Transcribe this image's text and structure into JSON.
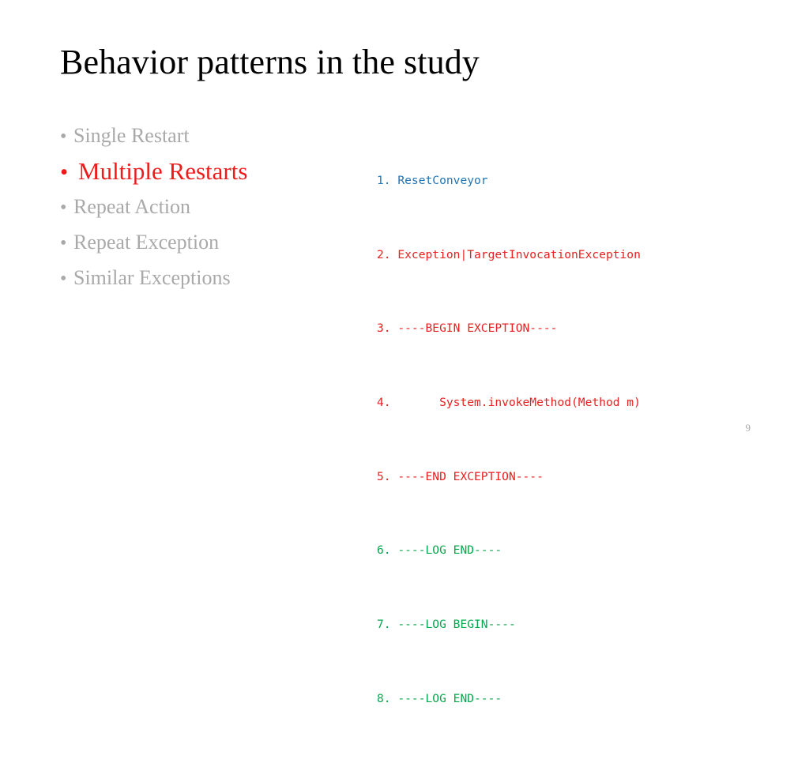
{
  "slide": {
    "title": "Behavior patterns in the study",
    "page_number": "9",
    "background_color": "#ffffff"
  },
  "colors": {
    "title_text": "#000000",
    "bullet_muted": "#a9a9a9",
    "bullet_highlight": "#ee1b1b",
    "code_blue": "#2074b4",
    "code_red": "#e8201f",
    "code_green": "#06a84e",
    "page_number": "#a6a6a6"
  },
  "bullets": [
    {
      "marker": "•",
      "label": "Single Restart",
      "style": "normal",
      "color": "#a9a9a9"
    },
    {
      "marker": "•",
      "label": " Multiple Restarts",
      "style": "highlight",
      "color": "#ee1b1b"
    },
    {
      "marker": "•",
      "label": "Repeat Action",
      "style": "normal",
      "color": "#a9a9a9"
    },
    {
      "marker": "•",
      "label": "Repeat Exception",
      "style": "normal",
      "color": "#a9a9a9"
    },
    {
      "marker": "•",
      "label": "Similar Exceptions",
      "style": "normal",
      "color": "#a9a9a9"
    }
  ],
  "code": {
    "lines": [
      {
        "number": "1.",
        "text": " ResetConveyor",
        "color_name": "blue",
        "color": "#2074b4"
      },
      {
        "number": "2.",
        "text": " Exception|TargetInvocationException",
        "color_name": "red",
        "color": "#e8201f"
      },
      {
        "number": "3.",
        "text": " ----BEGIN EXCEPTION----",
        "color_name": "red",
        "color": "#e8201f"
      },
      {
        "number": "4.",
        "text": "       System.invokeMethod(Method m)",
        "color_name": "red",
        "color": "#e8201f"
      },
      {
        "number": "5.",
        "text": " ----END EXCEPTION----",
        "color_name": "red",
        "color": "#e8201f"
      },
      {
        "number": "6.",
        "text": " ----LOG END----",
        "color_name": "green",
        "color": "#06a84e"
      },
      {
        "number": "7.",
        "text": " ----LOG BEGIN----",
        "color_name": "green",
        "color": "#06a84e"
      },
      {
        "number": "8.",
        "text": " ----LOG END----",
        "color_name": "green",
        "color": "#06a84e"
      }
    ]
  }
}
